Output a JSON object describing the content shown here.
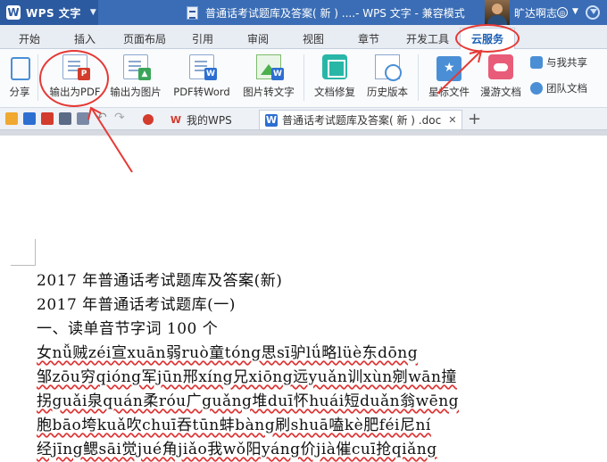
{
  "titlebar": {
    "app_name": "WPS 文字",
    "document_title": "普通话考试题库及答案( 新 ) ....- WPS 文字 - 兼容模式",
    "user_name": "旷达啊志"
  },
  "ribbon_tabs": [
    "开始",
    "插入",
    "页面布局",
    "引用",
    "审阅",
    "视图",
    "章节",
    "开发工具",
    "云服务"
  ],
  "active_tab": "云服务",
  "ribbon": {
    "share": "分享",
    "export_pdf": "输出为PDF",
    "export_image": "输出为图片",
    "pdf_to_word": "PDF转Word",
    "image_to_text": "图片转文字",
    "doc_repair": "文档修复",
    "history": "历史版本",
    "starred_files": "星标文件",
    "roaming_docs": "漫游文档",
    "shared_with_me": "与我共享",
    "team_docs": "团队文档"
  },
  "doc_tabs": {
    "my_wps": "我的WPS",
    "current_doc": "普通话考试题库及答案( 新 ) .doc"
  },
  "document": {
    "lines": [
      "2017 年普通话考试题库及答案(新)",
      "2017 年普通话考试题库(一)",
      "一、读单音节字词 100 个",
      "女nǚ贼zéi宣xuān弱ruò童tóng思sī驴lǘ略lüè东dōng",
      "邹zōu穷qióng军jūn邢xíng兄xiōng远yuǎn训xùn剜wān撞",
      "拐guǎi泉quán柔róu广guǎng堆duī怀huái短duǎn翁wēng",
      "胞bāo垮kuǎ吹chuī吞tūn蚌bàng刷shuā嗑kè肥féi尼ní",
      "经jīng鳃sāi觉jué角jiǎo我wǒ阳yáng价jià催cuī抢qiǎng"
    ]
  }
}
